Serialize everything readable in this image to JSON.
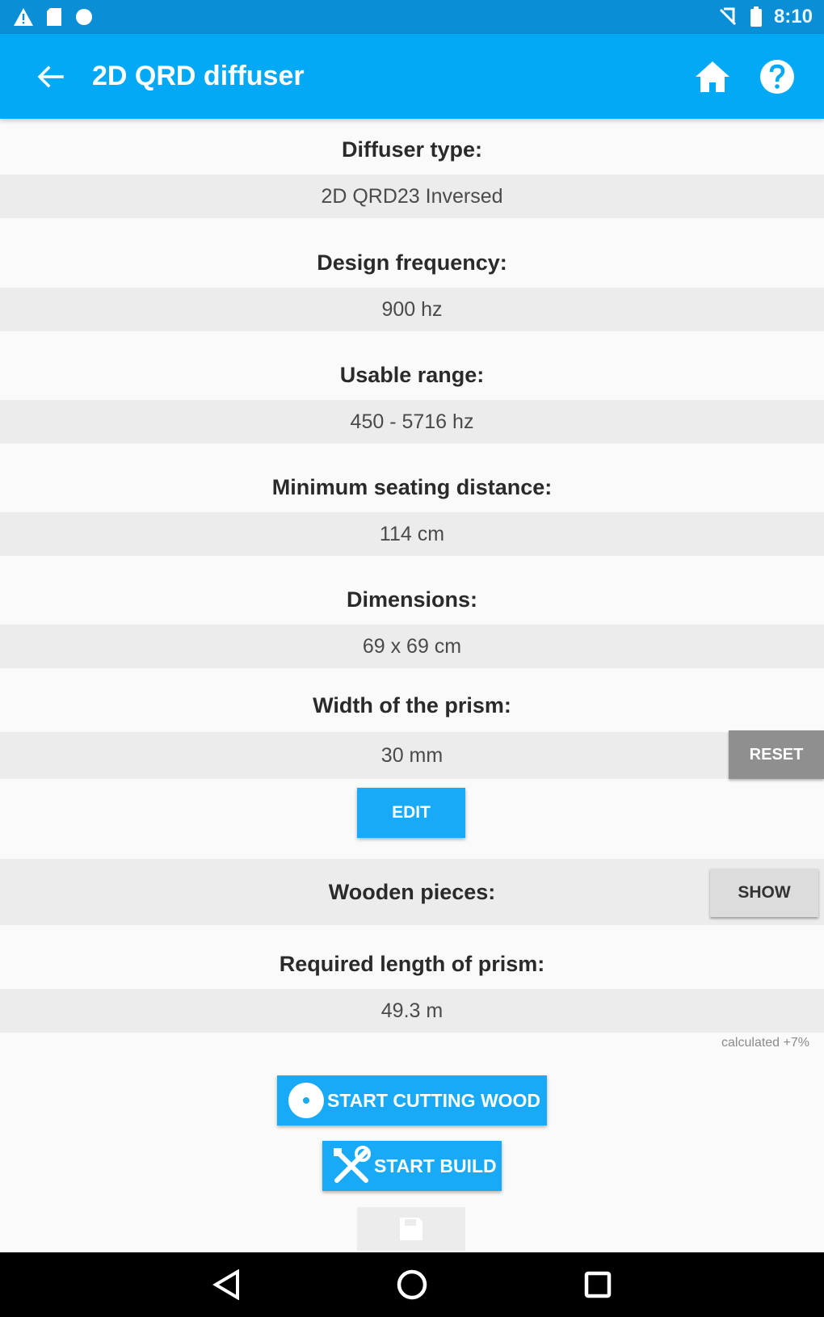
{
  "status_bar": {
    "time": "8:10",
    "left_icons": [
      "warning-icon",
      "sd-card-icon",
      "android-icon"
    ],
    "right_icons": [
      "no-sim-icon",
      "battery-icon"
    ]
  },
  "app_bar": {
    "title": "2D QRD diffuser",
    "icons": [
      "back-arrow-icon",
      "home-icon",
      "help-icon"
    ]
  },
  "fields": {
    "diffuser_type": {
      "label": "Diffuser type:",
      "value": "2D QRD23 Inversed"
    },
    "design_frequency": {
      "label": "Design frequency:",
      "value": "900 hz"
    },
    "usable_range": {
      "label": "Usable range:",
      "value": "450 - 5716 hz"
    },
    "min_seating": {
      "label": "Minimum seating distance:",
      "value": "114 cm"
    },
    "dimensions": {
      "label": "Dimensions:",
      "value": "69 x 69 cm"
    },
    "prism_width": {
      "label": "Width of the prism:",
      "value": "30 mm",
      "reset_label": "RESET",
      "edit_label": "EDIT"
    },
    "wooden_pieces": {
      "label": "Wooden pieces:",
      "show_label": "SHOW"
    },
    "prism_length": {
      "label": "Required length of prism:",
      "value": "49.3 m",
      "note": "calculated +7%"
    }
  },
  "actions": {
    "start_cutting": "START CUTTING WOOD",
    "start_build": "START BUILD"
  },
  "colors": {
    "primary": "#03a9f4",
    "status_bar": "#0a8fd6",
    "button_blue": "#18aaf7",
    "band_gray": "#ececec",
    "reset_gray": "#8f8f8f"
  }
}
